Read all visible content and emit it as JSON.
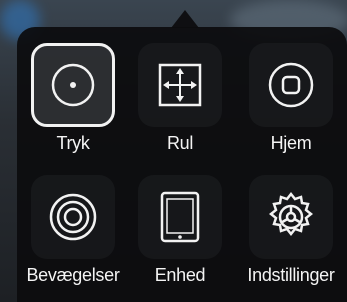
{
  "menu": {
    "items": [
      {
        "label": "Tryk",
        "icon": "tap-icon"
      },
      {
        "label": "Rul",
        "icon": "scroll-arrows-icon"
      },
      {
        "label": "Hjem",
        "icon": "home-button-icon"
      },
      {
        "label": "Bevægelser",
        "icon": "gestures-icon"
      },
      {
        "label": "Enhed",
        "icon": "device-icon"
      },
      {
        "label": "Indstillinger",
        "icon": "settings-gear-icon"
      }
    ],
    "selected_index": 0
  },
  "colors": {
    "panel": "#0c0c0e",
    "icon": "#f2f2f2"
  }
}
